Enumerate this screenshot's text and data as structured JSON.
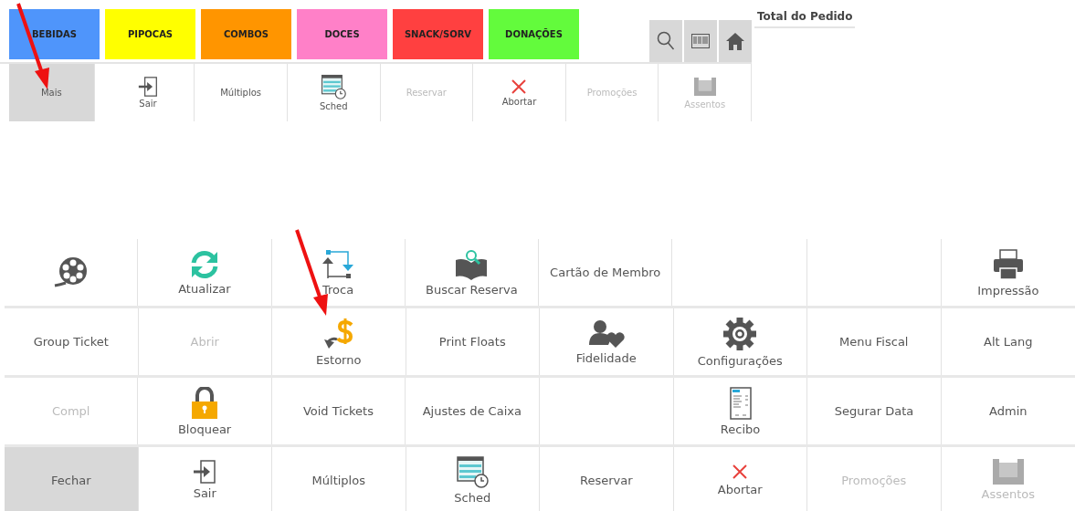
{
  "categories": [
    {
      "label": "BEBIDAS",
      "color": "#4f95fb"
    },
    {
      "label": "PIPOCAS",
      "color": "#ffff00"
    },
    {
      "label": "COMBOS",
      "color": "#ff9500"
    },
    {
      "label": "DOCES",
      "color": "#ff80c8"
    },
    {
      "label": "SNACK/SORV",
      "color": "#ff4040"
    },
    {
      "label": "DONAÇÕES",
      "color": "#63fb3c"
    }
  ],
  "order_panel": {
    "title": "Total do Pedido"
  },
  "action_bar": [
    {
      "label": "Mais",
      "kind": "text",
      "disabled": false,
      "selected": true,
      "pointed": true
    },
    {
      "label": "Sair",
      "kind": "exit",
      "disabled": false,
      "selected": false,
      "pointed": false
    },
    {
      "label": "Múltiplos",
      "kind": "text",
      "disabled": false,
      "selected": false,
      "pointed": false
    },
    {
      "label": "Sched",
      "kind": "schedule",
      "disabled": false,
      "selected": false,
      "pointed": false
    },
    {
      "label": "Reservar",
      "kind": "text",
      "disabled": true,
      "selected": false,
      "pointed": false
    },
    {
      "label": "Abortar",
      "kind": "close",
      "disabled": false,
      "selected": false,
      "pointed": false
    },
    {
      "label": "Promoções",
      "kind": "text",
      "disabled": true,
      "selected": false,
      "pointed": false
    },
    {
      "label": "Assentos",
      "kind": "seats",
      "disabled": true,
      "selected": false,
      "pointed": false
    }
  ],
  "menu_grid": [
    [
      {
        "kind": "film",
        "disabled": false,
        "selected": false,
        "pointed": false
      },
      {
        "label": "Atualizar",
        "kind": "refresh",
        "disabled": false,
        "selected": false,
        "pointed": false
      },
      {
        "label": "Troca",
        "kind": "swap",
        "disabled": false,
        "selected": false,
        "pointed": false
      },
      {
        "label": "Buscar Reserva",
        "kind": "book",
        "disabled": false,
        "selected": false,
        "pointed": false
      },
      {
        "label": "Cartão de Membro",
        "kind": "text",
        "disabled": false,
        "selected": false,
        "pointed": false
      },
      {
        "kind": "empty"
      },
      {
        "kind": "empty"
      },
      {
        "label": "Impressão",
        "kind": "printer",
        "disabled": false,
        "selected": false,
        "pointed": false
      }
    ],
    [
      {
        "label": "Group Ticket",
        "kind": "text",
        "disabled": false,
        "selected": false,
        "pointed": false
      },
      {
        "label": "Abrir",
        "kind": "text",
        "disabled": true,
        "selected": false,
        "pointed": false
      },
      {
        "label": "Estorno",
        "kind": "refund",
        "disabled": false,
        "selected": false,
        "pointed": true
      },
      {
        "label": "Print Floats",
        "kind": "text",
        "disabled": false,
        "selected": false,
        "pointed": false
      },
      {
        "label": "Fidelidade",
        "kind": "loyalty",
        "disabled": false,
        "selected": false,
        "pointed": false
      },
      {
        "label": "Configurações",
        "kind": "gear",
        "disabled": false,
        "selected": false,
        "pointed": false
      },
      {
        "label": "Menu Fiscal",
        "kind": "text",
        "disabled": false,
        "selected": false,
        "pointed": false
      },
      {
        "label": "Alt Lang",
        "kind": "text",
        "disabled": false,
        "selected": false,
        "pointed": false
      }
    ],
    [
      {
        "label": "Compl",
        "kind": "text",
        "disabled": true,
        "selected": false,
        "pointed": false
      },
      {
        "label": "Bloquear",
        "kind": "lock",
        "disabled": false,
        "selected": false,
        "pointed": false
      },
      {
        "label": "Void Tickets",
        "kind": "text",
        "disabled": false,
        "selected": false,
        "pointed": false
      },
      {
        "label": "Ajustes de Caixa",
        "kind": "text",
        "disabled": false,
        "selected": false,
        "pointed": false
      },
      {
        "kind": "empty"
      },
      {
        "label": "Recibo",
        "kind": "receipt",
        "disabled": false,
        "selected": false,
        "pointed": false
      },
      {
        "label": "Segurar Data",
        "kind": "text",
        "disabled": false,
        "selected": false,
        "pointed": false
      },
      {
        "label": "Admin",
        "kind": "text",
        "disabled": false,
        "selected": false,
        "pointed": false
      }
    ],
    [
      {
        "label": "Fechar",
        "kind": "text",
        "disabled": false,
        "selected": true,
        "pointed": false
      },
      {
        "label": "Sair",
        "kind": "exit",
        "disabled": false,
        "selected": false,
        "pointed": false
      },
      {
        "label": "Múltiplos",
        "kind": "text",
        "disabled": false,
        "selected": false,
        "pointed": false
      },
      {
        "label": "Sched",
        "kind": "schedule",
        "disabled": false,
        "selected": false,
        "pointed": false
      },
      {
        "label": "Reservar",
        "kind": "text",
        "disabled": false,
        "selected": false,
        "pointed": false
      },
      {
        "label": "Abortar",
        "kind": "close",
        "disabled": false,
        "selected": false,
        "pointed": false
      },
      {
        "label": "Promoções",
        "kind": "text",
        "disabled": true,
        "selected": false,
        "pointed": false
      },
      {
        "label": "Assentos",
        "kind": "seats",
        "disabled": true,
        "selected": false,
        "pointed": false
      }
    ]
  ]
}
